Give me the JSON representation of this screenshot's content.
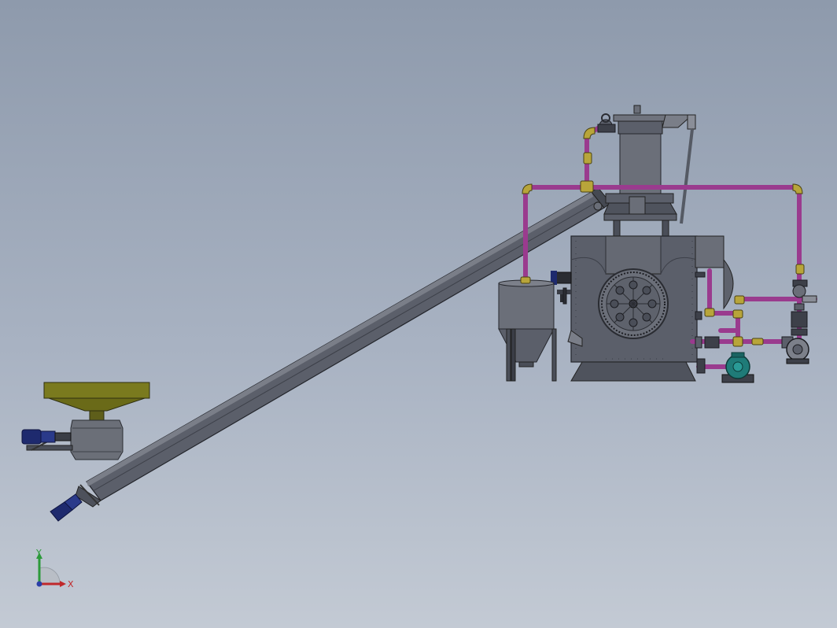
{
  "viewport": {
    "background_top": "#8e9aac",
    "background_bottom": "#c3cad4"
  },
  "colors": {
    "steel": "#5b5f6a",
    "steel_light": "#7a7e88",
    "steel_dark": "#3d4049",
    "pipe_magenta": "#9a3b8e",
    "pipe_fitting_yellow": "#b8a53a",
    "hopper_olive": "#7a7a1e",
    "pump_teal": "#1f7b78",
    "motor_blue": "#1e2a6e"
  },
  "components": {
    "feed_hopper": "feed-hopper",
    "screw_conveyor": "inclined-screw-conveyor",
    "gasifier": "gasifier-reactor",
    "chimney": "exhaust-stack",
    "ash_bin": "ash-collection-bin",
    "pump": "circulation-pump",
    "piping": "process-piping"
  },
  "triad": {
    "x_label": "X",
    "y_label": "Y",
    "x_color": "#c0282b",
    "y_color": "#2c9a3a",
    "z_color": "#2b3fa8"
  }
}
